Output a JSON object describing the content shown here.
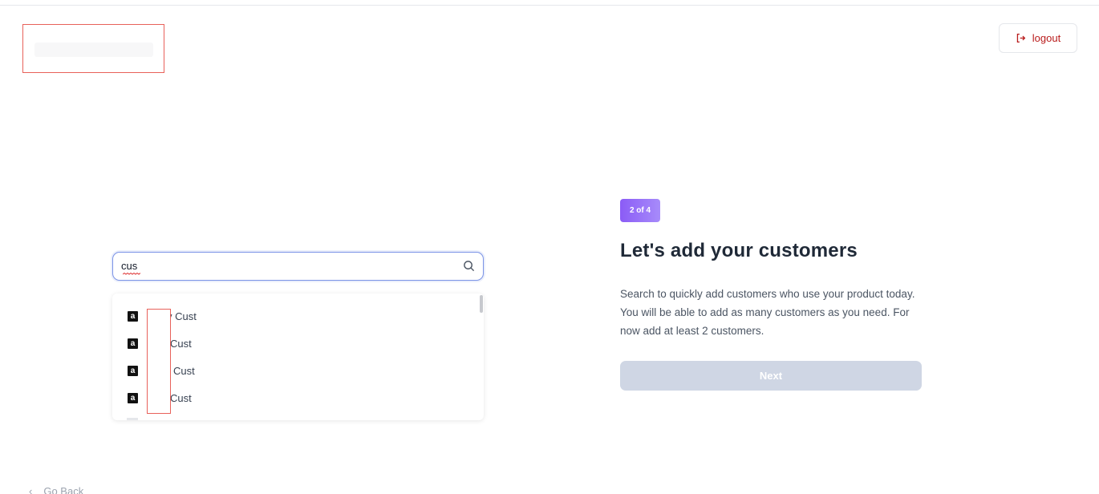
{
  "header": {
    "logout_label": "logout"
  },
  "search": {
    "value": "cus"
  },
  "results": [
    {
      "text": "v Cust",
      "logo": "a"
    },
    {
      "text": "Cust",
      "logo": "a"
    },
    {
      "text": "Cust",
      "logo": "a"
    },
    {
      "text": "Cust",
      "logo": "a"
    }
  ],
  "onboarding": {
    "step": "2 of 4",
    "title": "Let's add your customers",
    "description": "Search to quickly add customers who use your product today. You will be able to add as many customers as you need. For now add at least 2 customers.",
    "next_label": "Next"
  },
  "footer": {
    "go_back_label": "Go Back"
  },
  "colors": {
    "accent": "#7b93e6",
    "badge": "#8b5cf6",
    "logout": "#b91c1c",
    "disabled_button": "#cfd6e4",
    "redaction": "#e8615a"
  }
}
